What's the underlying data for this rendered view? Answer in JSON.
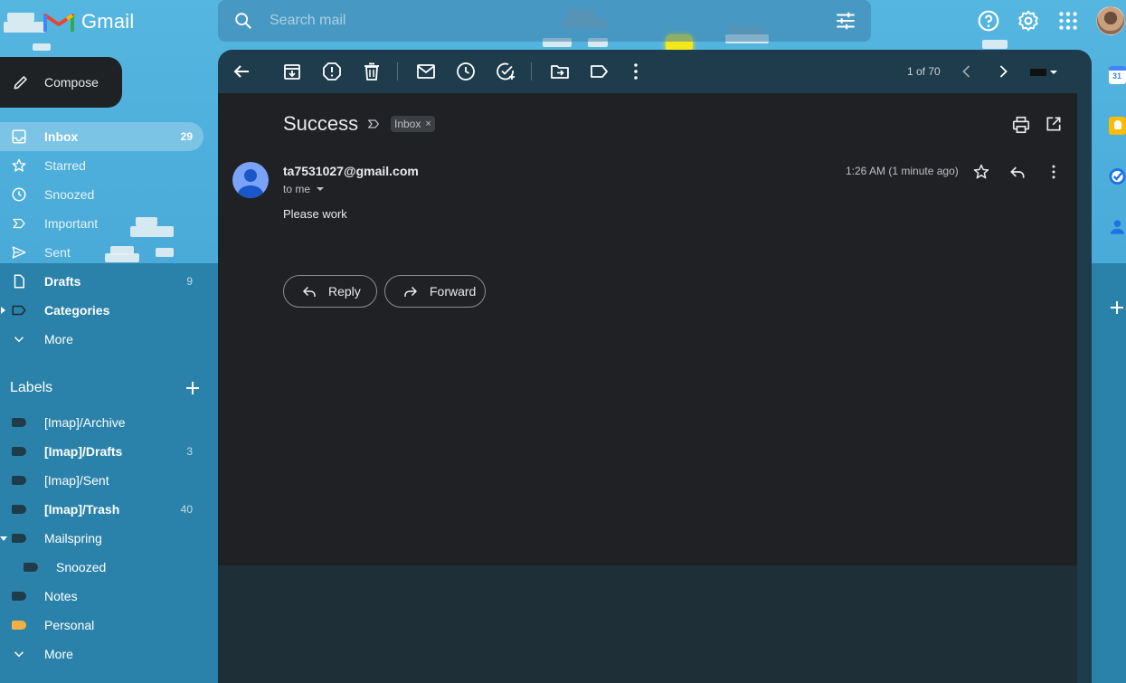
{
  "header": {
    "app_name": "Gmail",
    "search_placeholder": "Search mail"
  },
  "compose": {
    "label": "Compose"
  },
  "nav": [
    {
      "label": "Inbox",
      "count": "29",
      "icon": "inbox-icon"
    },
    {
      "label": "Starred",
      "count": "",
      "icon": "star-icon"
    },
    {
      "label": "Snoozed",
      "count": "",
      "icon": "clock-icon"
    },
    {
      "label": "Important",
      "count": "",
      "icon": "important-icon"
    },
    {
      "label": "Sent",
      "count": "",
      "icon": "send-icon"
    },
    {
      "label": "Drafts",
      "count": "9",
      "icon": "draft-icon"
    },
    {
      "label": "Categories",
      "count": "",
      "icon": "label-icon"
    },
    {
      "label": "More",
      "count": "",
      "icon": "chevron-down-icon"
    }
  ],
  "labels": {
    "heading": "Labels",
    "items": [
      {
        "label": "[Imap]/Archive",
        "count": ""
      },
      {
        "label": "[Imap]/Drafts",
        "count": "3"
      },
      {
        "label": "[Imap]/Sent",
        "count": ""
      },
      {
        "label": "[Imap]/Trash",
        "count": "40"
      },
      {
        "label": "Mailspring",
        "count": ""
      },
      {
        "label": "Snoozed",
        "count": ""
      },
      {
        "label": "Notes",
        "count": ""
      },
      {
        "label": "Personal",
        "count": ""
      },
      {
        "label": "More",
        "count": ""
      }
    ]
  },
  "toolbar": {
    "pager": "1 of 70"
  },
  "email": {
    "subject": "Success",
    "chip": "Inbox",
    "sender": "ta7531027@gmail.com",
    "recipient": "to me",
    "time": "1:26 AM (1 minute ago)",
    "body": "Please work",
    "reply_label": "Reply",
    "forward_label": "Forward"
  },
  "colors": {
    "accent_personal": "#f4b042",
    "email_bg": "#202124",
    "toolbar_bg": "#1e3c4c"
  }
}
